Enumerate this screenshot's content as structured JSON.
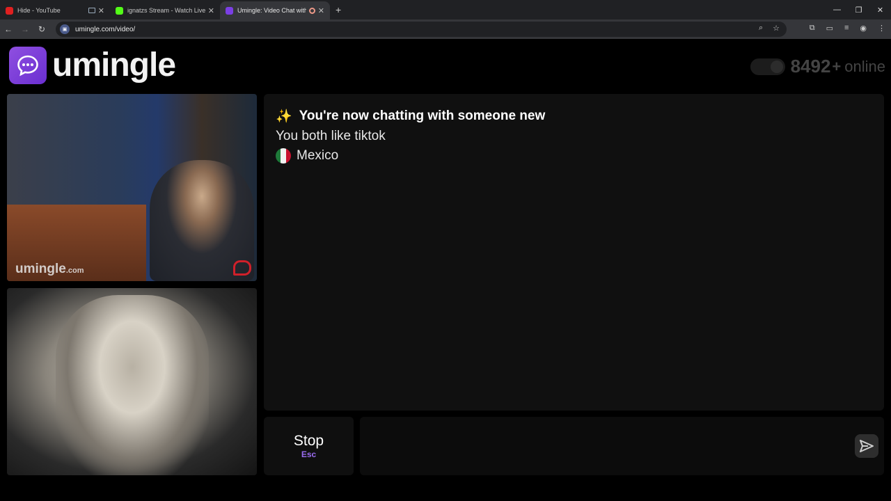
{
  "browser": {
    "tabs": [
      {
        "title": "Hide - YouTube",
        "active": false
      },
      {
        "title": "ignatzs Stream - Watch Live on",
        "active": false
      },
      {
        "title": "Umingle: Video Chat with S",
        "active": true
      }
    ],
    "url": "umingle.com/video/"
  },
  "site": {
    "brand": "umingle",
    "online_count": "8492",
    "online_plus": "+",
    "online_label": "online",
    "watermark_main": "umingle",
    "watermark_suffix": ".com",
    "accent": "#7b3fe4"
  },
  "chat": {
    "headline": "You're now chatting with someone new",
    "interest": "You both like tiktok",
    "country": "Mexico"
  },
  "controls": {
    "stop_label": "Stop",
    "stop_key": "Esc",
    "message_placeholder": ""
  }
}
